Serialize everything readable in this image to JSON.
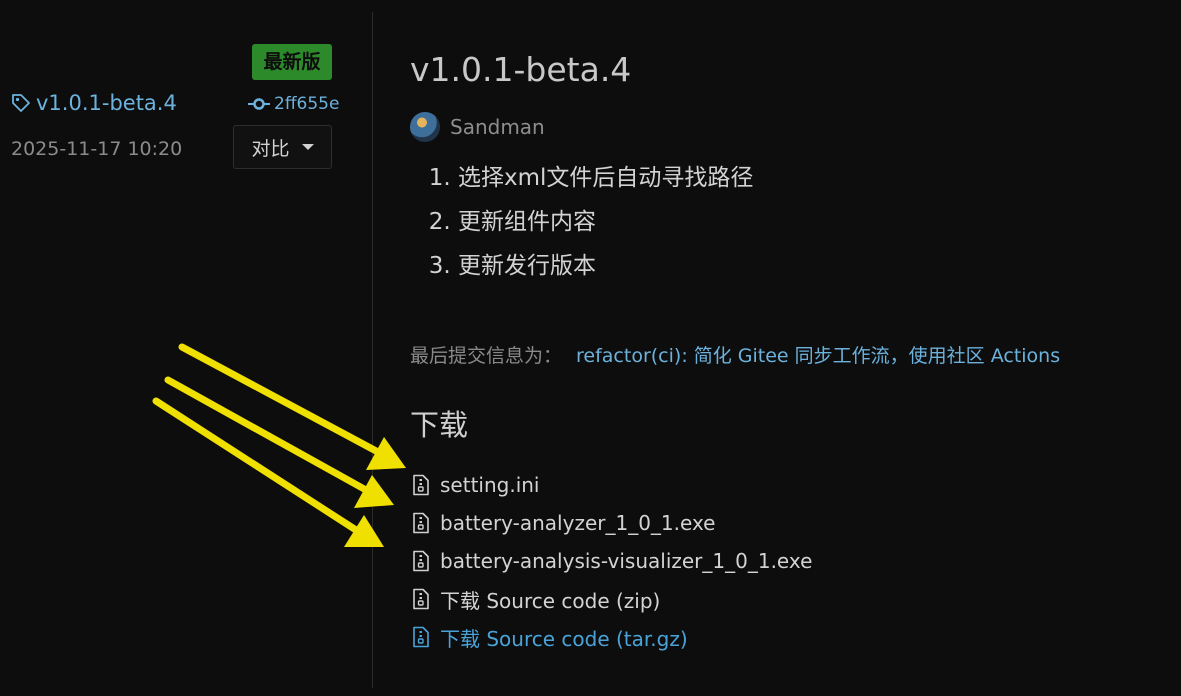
{
  "sidebar": {
    "latest_badge": "最新版",
    "tag": "v1.0.1-beta.4",
    "commit": "2ff655e",
    "date": "2025-11-17 10:20",
    "compare_label": "对比"
  },
  "release": {
    "title": "v1.0.1-beta.4",
    "author": "Sandman",
    "notes": [
      "选择xml文件后自动寻找路径",
      "更新组件内容",
      "更新发行版本"
    ],
    "last_commit_label": "最后提交信息为：",
    "last_commit_message": "refactor(ci): 简化 Gitee 同步工作流，使用社区 Actions"
  },
  "downloads": {
    "heading": "下载",
    "files": [
      "setting.ini",
      "battery-analyzer_1_0_1.exe",
      "battery-analysis-visualizer_1_0_1.exe",
      "下载 Source code (zip)",
      "下载 Source code (tar.gz)"
    ]
  },
  "colors": {
    "background": "#0d0d0d",
    "link": "#6cb2dd",
    "badge": "#2d8a2a",
    "annotation_arrow": "#f0e000"
  },
  "icons": [
    "tag-icon",
    "commit-icon",
    "caret-down-icon",
    "file-zip-icon",
    "annotation-arrow-icon"
  ]
}
